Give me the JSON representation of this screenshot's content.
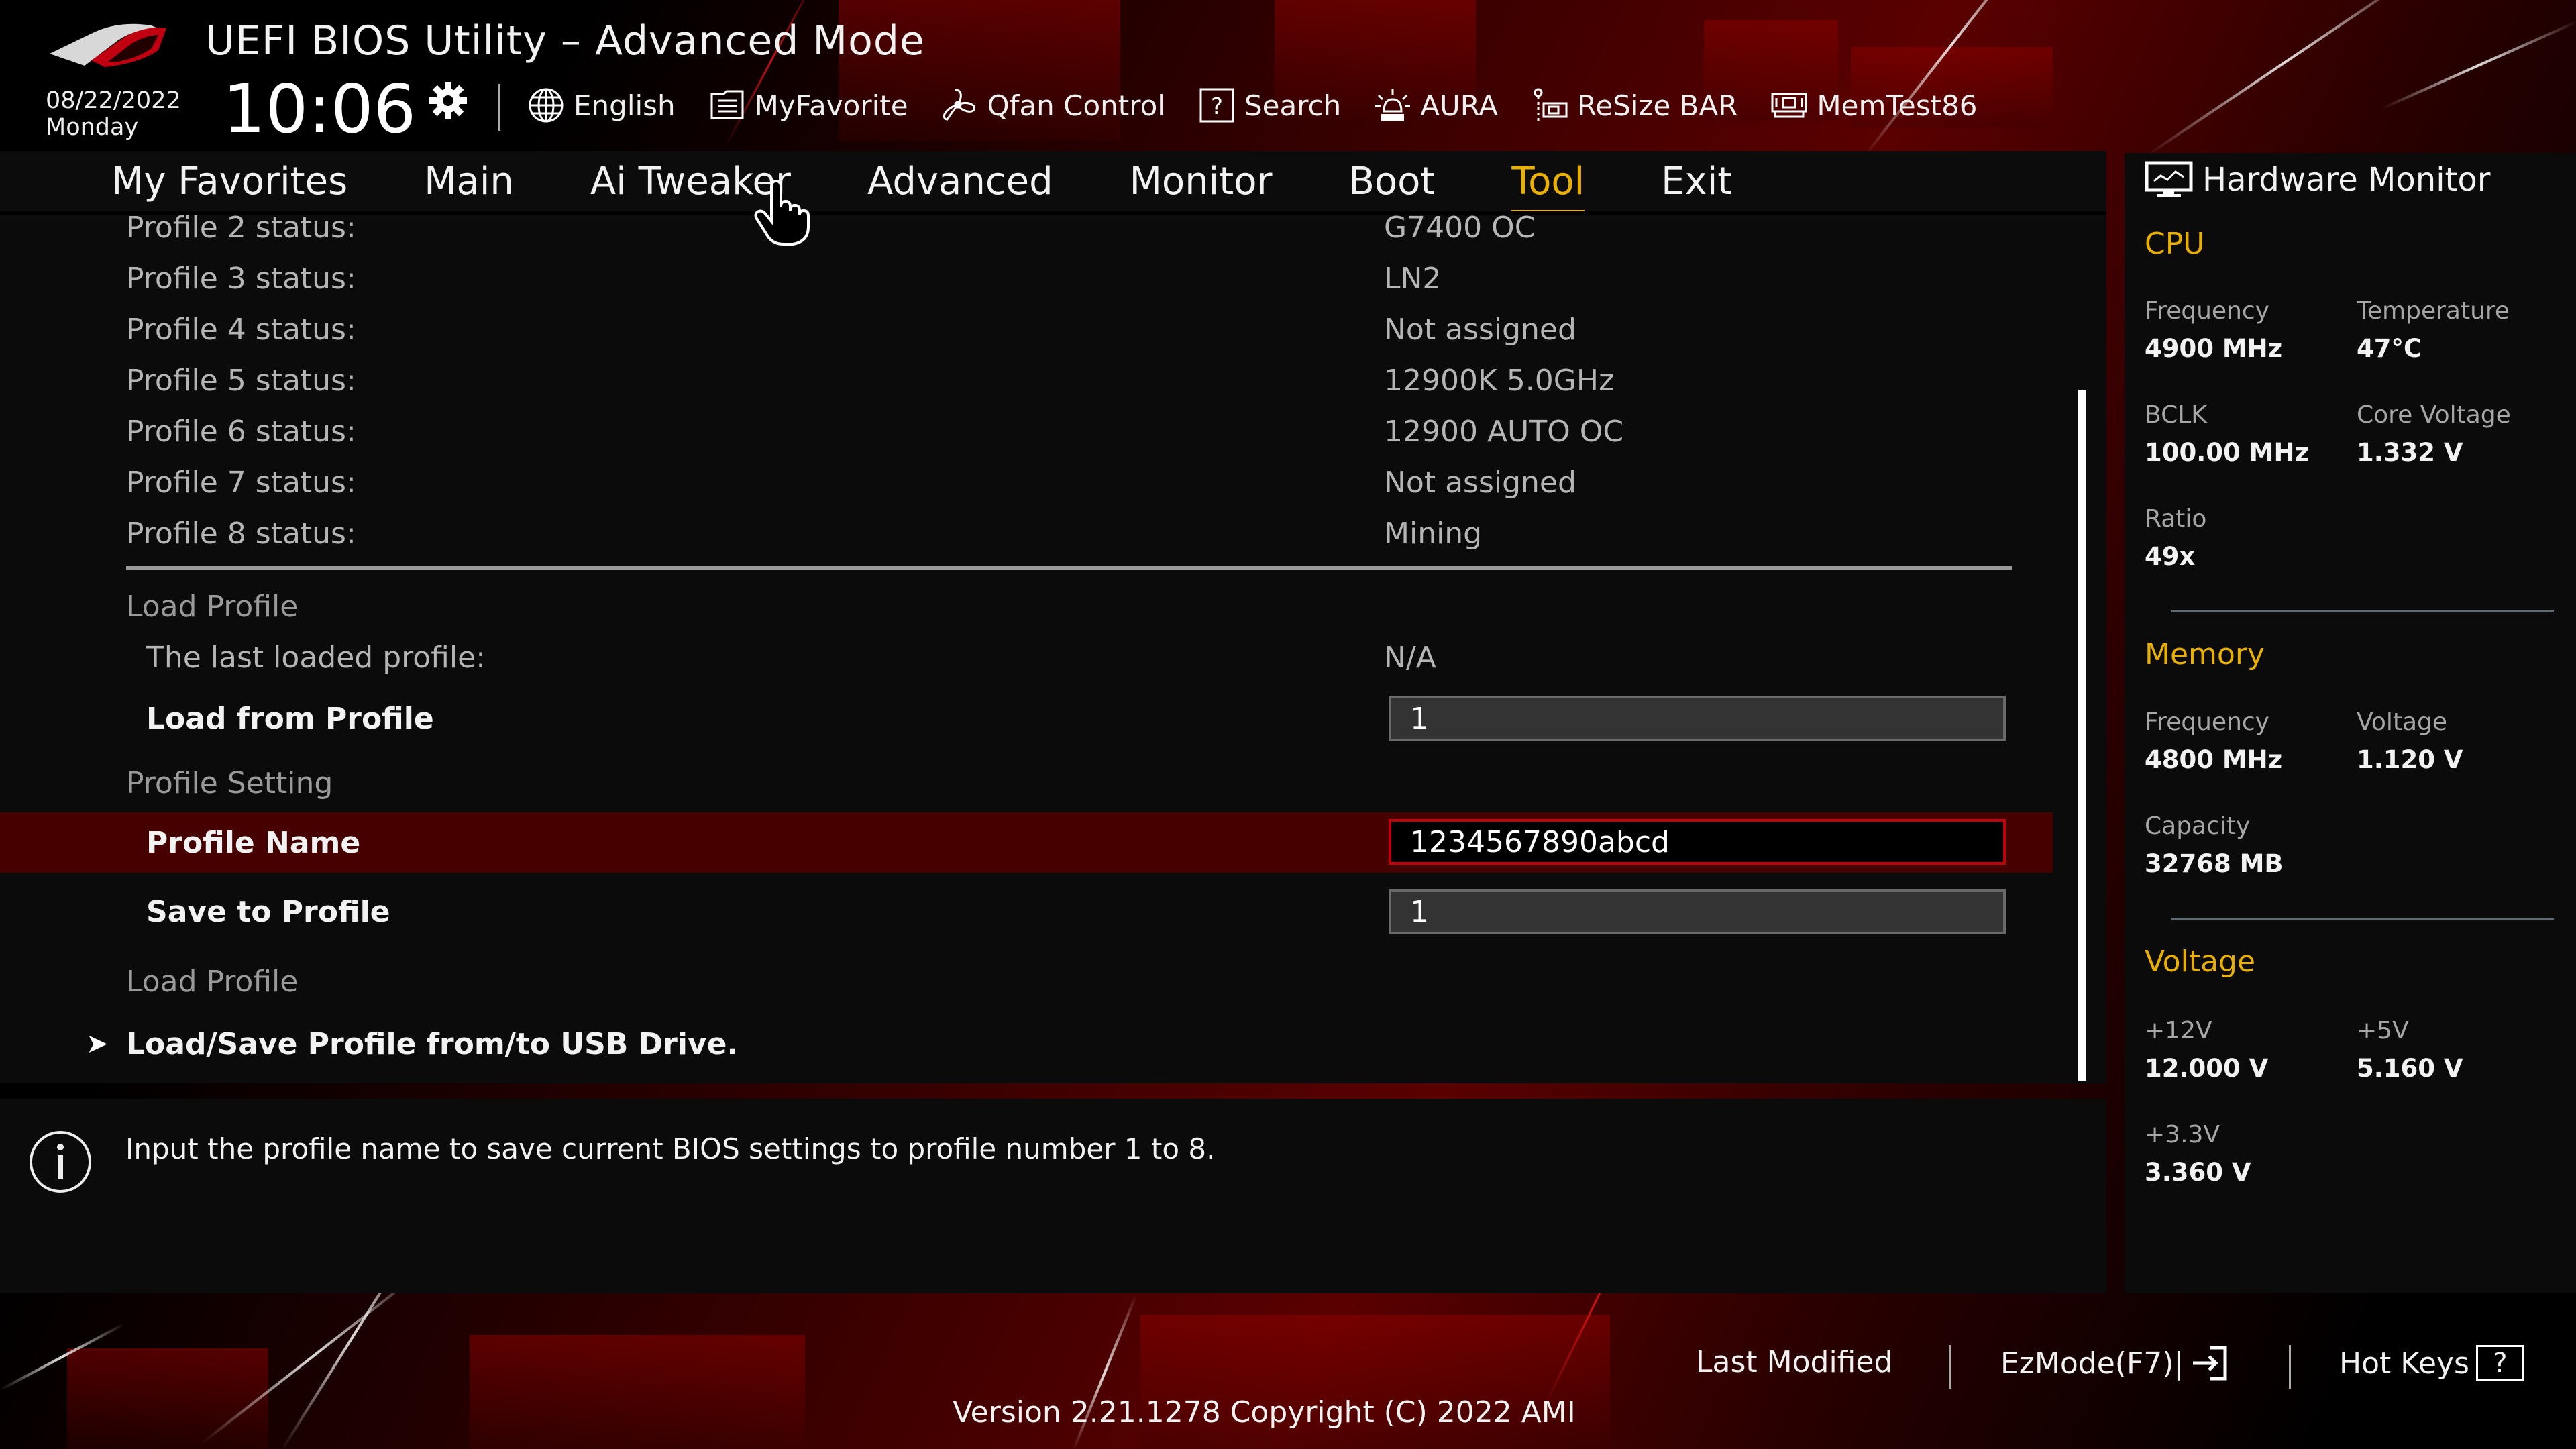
{
  "header": {
    "title": "UEFI BIOS Utility – Advanced Mode",
    "date": "08/22/2022",
    "day": "Monday",
    "time": "10:06",
    "toolbar": [
      {
        "icon": "globe-icon",
        "label": "English"
      },
      {
        "icon": "favorite-list-icon",
        "label": "MyFavorite"
      },
      {
        "icon": "fan-icon",
        "label": "Qfan Control"
      },
      {
        "icon": "search-help-icon",
        "label": "Search"
      },
      {
        "icon": "aura-light-icon",
        "label": "AURA"
      },
      {
        "icon": "resize-bar-icon",
        "label": "ReSize BAR"
      },
      {
        "icon": "memory-module-icon",
        "label": "MemTest86"
      }
    ]
  },
  "nav": {
    "tabs": [
      "My Favorites",
      "Main",
      "Ai Tweaker",
      "Advanced",
      "Monitor",
      "Boot",
      "Tool",
      "Exit"
    ],
    "active": "Tool"
  },
  "main": {
    "profiles": [
      {
        "label": "Profile 2 status:",
        "value": "G7400 OC"
      },
      {
        "label": "Profile 3 status:",
        "value": "LN2"
      },
      {
        "label": "Profile 4 status:",
        "value": "Not assigned"
      },
      {
        "label": "Profile 5 status:",
        "value": "12900K 5.0GHz"
      },
      {
        "label": "Profile 6 status:",
        "value": "12900 AUTO OC"
      },
      {
        "label": "Profile 7 status:",
        "value": "Not assigned"
      },
      {
        "label": "Profile 8 status:",
        "value": "Mining"
      }
    ],
    "load_section": "Load Profile",
    "last_loaded_label": "The last loaded profile:",
    "last_loaded_value": "N/A",
    "load_from_label": "Load from Profile",
    "load_from_value": "1",
    "profile_setting_section": "Profile Setting",
    "profile_name_label": "Profile Name",
    "profile_name_value": "1234567890abcd",
    "save_to_label": "Save to Profile",
    "save_to_value": "1",
    "load_section_2": "Load Profile",
    "usb_link": "Load/Save Profile from/to USB Drive."
  },
  "help": {
    "message": "Input the profile name to save current BIOS settings to profile number 1 to 8."
  },
  "hardware_monitor": {
    "title": "Hardware Monitor",
    "cpu": {
      "heading": "CPU",
      "frequency_label": "Frequency",
      "frequency": "4900 MHz",
      "temperature_label": "Temperature",
      "temperature": "47°C",
      "bclk_label": "BCLK",
      "bclk": "100.00 MHz",
      "core_voltage_label": "Core Voltage",
      "core_voltage": "1.332 V",
      "ratio_label": "Ratio",
      "ratio": "49x"
    },
    "memory": {
      "heading": "Memory",
      "frequency_label": "Frequency",
      "frequency": "4800 MHz",
      "voltage_label": "Voltage",
      "voltage": "1.120 V",
      "capacity_label": "Capacity",
      "capacity": "32768 MB"
    },
    "voltage": {
      "heading": "Voltage",
      "v12_label": "+12V",
      "v12": "12.000 V",
      "v5_label": "+5V",
      "v5": "5.160 V",
      "v33_label": "+3.3V",
      "v33": "3.360 V"
    }
  },
  "footer": {
    "last_modified": "Last Modified",
    "ezmode": "EzMode(F7)|",
    "hotkeys": "Hot Keys",
    "hotkeys_icon_glyph": "?",
    "version": "Version 2.21.1278 Copyright (C) 2022 AMI"
  },
  "colors": {
    "accent": "#e9b000",
    "selected_row": "#470000",
    "active_field_border": "#c0000a"
  }
}
